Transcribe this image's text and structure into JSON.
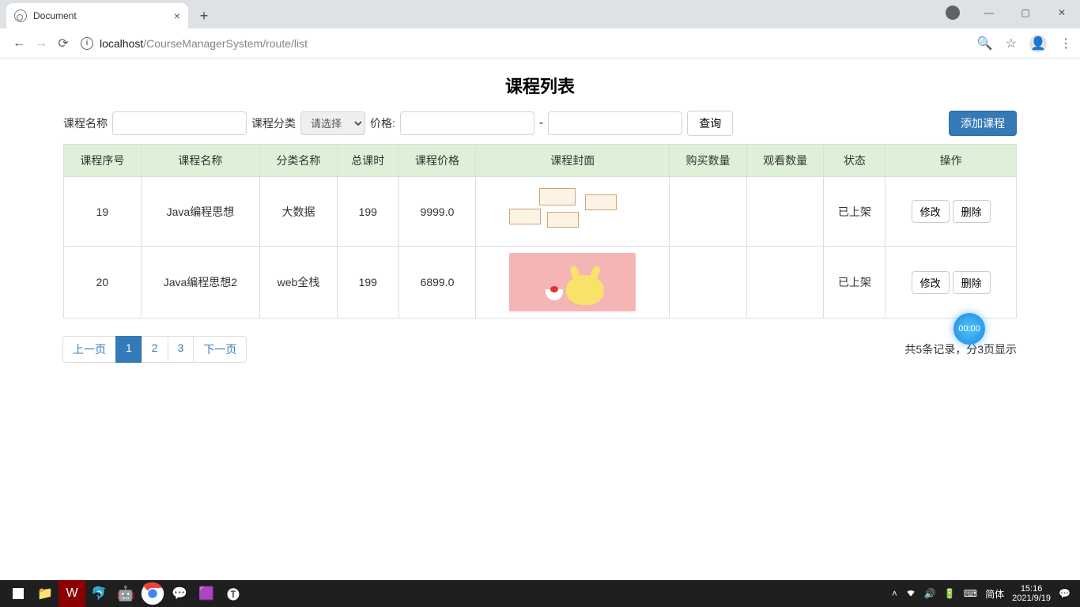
{
  "browser": {
    "tab_title": "Document",
    "url_host": "localhost",
    "url_path": "/CourseManagerSystem/route/list"
  },
  "page": {
    "title": "课程列表",
    "filters": {
      "name_label": "课程名称",
      "category_label": "课程分类",
      "category_placeholder": "请选择",
      "price_label": "价格:",
      "price_separator": "-",
      "search_button": "查询",
      "add_button": "添加课程"
    },
    "table": {
      "headers": [
        "课程序号",
        "课程名称",
        "分类名称",
        "总课时",
        "课程价格",
        "课程封面",
        "购买数量",
        "观看数量",
        "状态",
        "操作"
      ],
      "rows": [
        {
          "id": "19",
          "name": "Java编程思想",
          "category": "大数据",
          "hours": "199",
          "price": "9999.0",
          "cover": "wireframe",
          "buy": "",
          "view": "",
          "status": "已上架"
        },
        {
          "id": "20",
          "name": "Java编程思想2",
          "category": "web全栈",
          "hours": "199",
          "price": "6899.0",
          "cover": "pika",
          "buy": "",
          "view": "",
          "status": "已上架"
        }
      ],
      "row_buttons": {
        "edit": "修改",
        "delete": "删除"
      }
    },
    "pagination": {
      "prev": "上一页",
      "next": "下一页",
      "pages": [
        "1",
        "2",
        "3"
      ],
      "active_index": 0,
      "summary": "共5条记录，分3页显示"
    },
    "timer": "00:00"
  },
  "system": {
    "ime": "简体",
    "time": "15:16",
    "date": "2021/9/19"
  }
}
